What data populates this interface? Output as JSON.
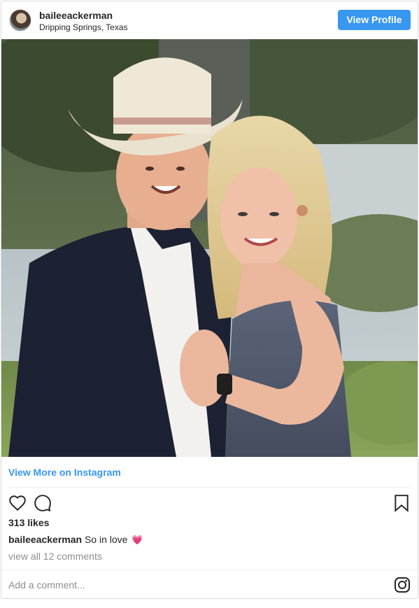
{
  "header": {
    "username": "baileeackerman",
    "location": "Dripping Springs, Texas",
    "view_profile_label": "View Profile"
  },
  "photo": {
    "alt": "Couple photo"
  },
  "footer": {
    "view_more_label": "View More on Instagram",
    "likes": "313 likes",
    "caption_user": "baileeackerman",
    "caption_text": "So in love",
    "caption_emoji": "💗",
    "view_comments": "view all 12 comments",
    "add_comment_placeholder": "Add a comment..."
  },
  "icons": {
    "like": "heart-outline-icon",
    "comment": "comment-bubble-icon",
    "save": "bookmark-icon",
    "brand": "instagram-icon"
  },
  "colors": {
    "accent": "#3897f0",
    "text": "#262626",
    "muted": "#8e8e8e",
    "border": "#dbdbdb"
  }
}
